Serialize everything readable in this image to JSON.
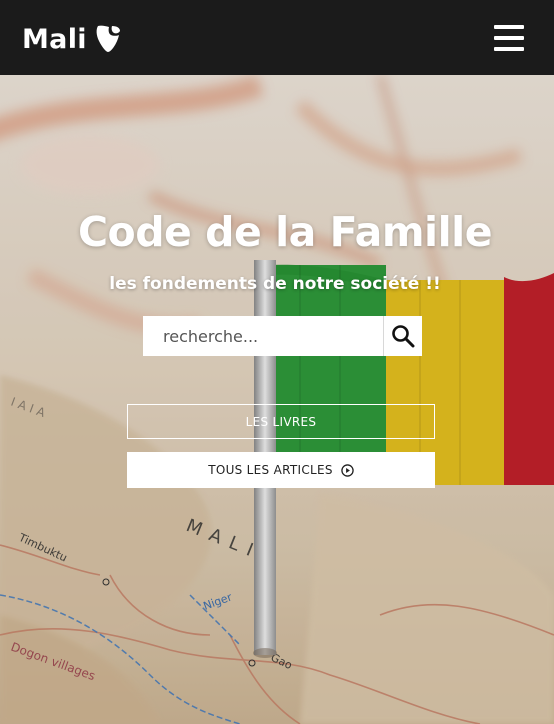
{
  "navbar": {
    "brand_text": "Mali",
    "brand_logo_icon": "typo3-logo-icon",
    "menu_icon": "hamburger-menu-icon",
    "background_color": "#1b1b1b"
  },
  "hero": {
    "title": "Code de la Famille",
    "subtitle": "les fondements de notre société !!",
    "search": {
      "placeholder": "recherche...",
      "value": "",
      "icon": "search-icon"
    },
    "buttons": {
      "books_label": "LES LIVRES",
      "articles_label": "TOUS LES ARTICLES",
      "articles_icon": "play-circle-icon"
    },
    "map_labels": {
      "country": "MALI",
      "city": "Timbuktu",
      "river": "Niger",
      "town": "Gao",
      "region": "Dogon villages"
    },
    "flag_colors": [
      "#2e9a3c",
      "#e8c21e",
      "#c4202a"
    ]
  }
}
